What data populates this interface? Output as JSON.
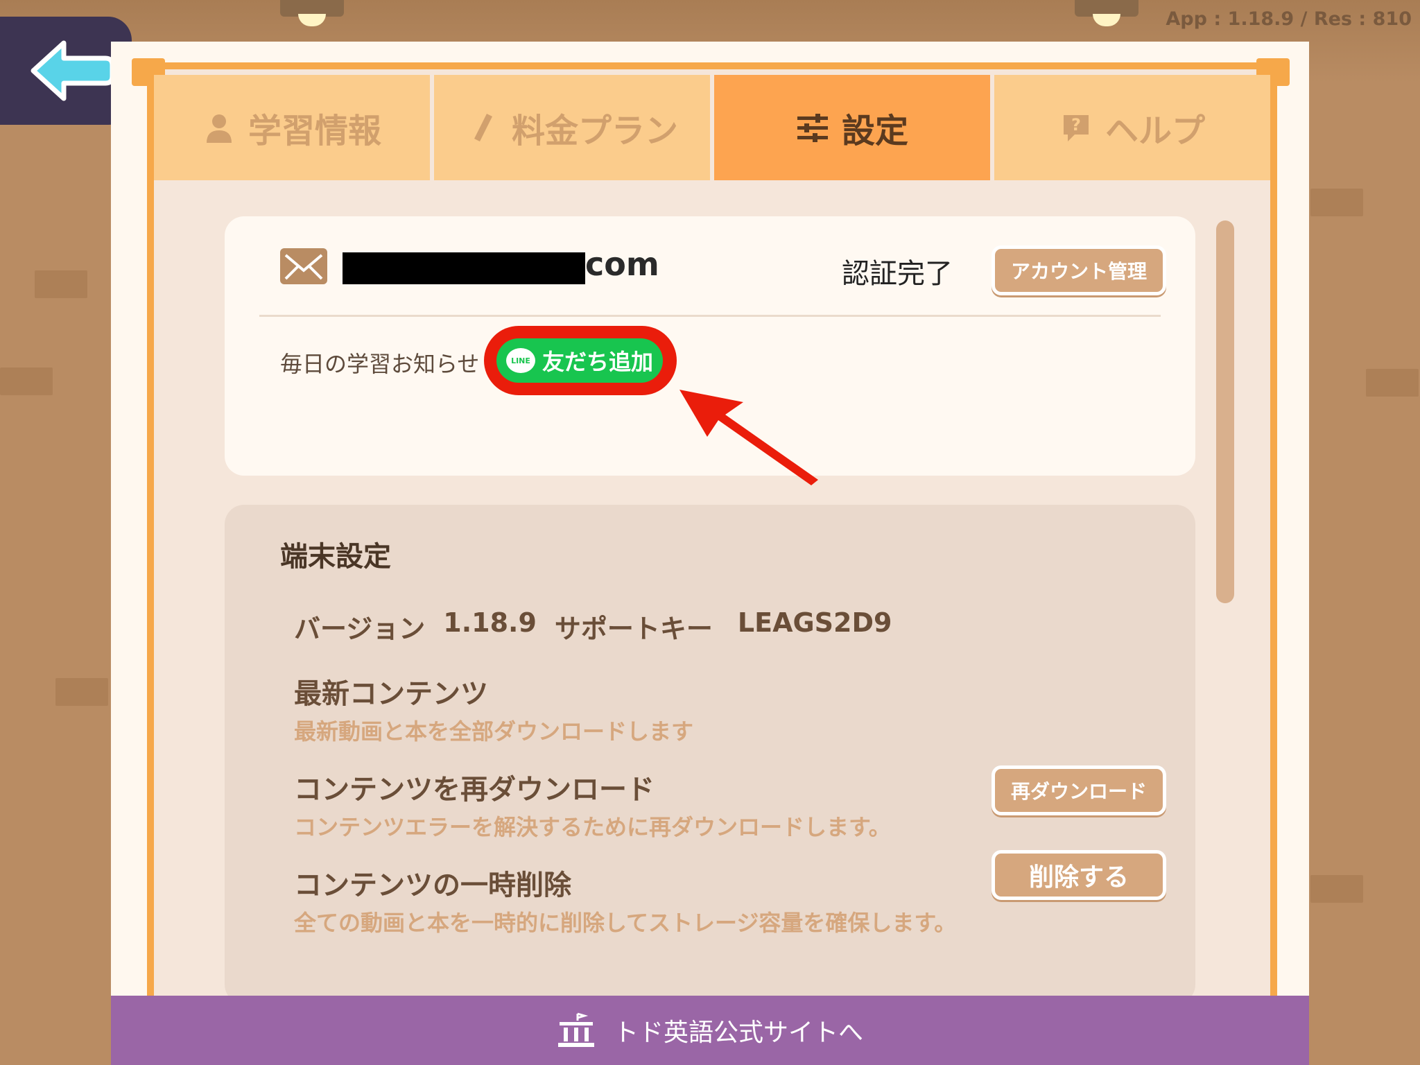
{
  "app_version_text": "App : 1.18.9 / Res : 810",
  "tabs": [
    {
      "label": "学習情報",
      "icon": "person-icon",
      "active": false
    },
    {
      "label": "料金プラン",
      "icon": "pencil-icon",
      "active": false
    },
    {
      "label": "設定",
      "icon": "sliders-icon",
      "active": true
    },
    {
      "label": "ヘルプ",
      "icon": "question-icon",
      "active": false
    }
  ],
  "account": {
    "email_suffix": "com",
    "verified_label": "認証完了",
    "manage_button": "アカウント管理",
    "notice_label": "毎日の学習お知らせ",
    "line_logo_text": "LINE",
    "line_button": "友だち追加"
  },
  "device": {
    "title": "端末設定",
    "version_label": "バージョン",
    "version_value": "1.18.9",
    "support_key_label": "サポートキー",
    "support_key_value": "LEAGS2D9",
    "latest_title": "最新コンテンツ",
    "latest_sub": "最新動画と本を全部ダウンロードします",
    "redownload_title": "コンテンツを再ダウンロード",
    "redownload_sub": "コンテンツエラーを解決するために再ダウンロードします。",
    "redownload_button": "再ダウンロード",
    "delete_title": "コンテンツの一時削除",
    "delete_sub": "全ての動画と本を一時的に削除してストレージ容量を確保します。",
    "delete_button": "削除する"
  },
  "footer": {
    "label": "トド英語公式サイトへ"
  },
  "colors": {
    "tab_active": "#fda450",
    "tab_inactive": "#fbcc8c",
    "line_green": "#18c54f",
    "highlight_red": "#ea1d0b",
    "footer_purple": "#9a66a6"
  }
}
